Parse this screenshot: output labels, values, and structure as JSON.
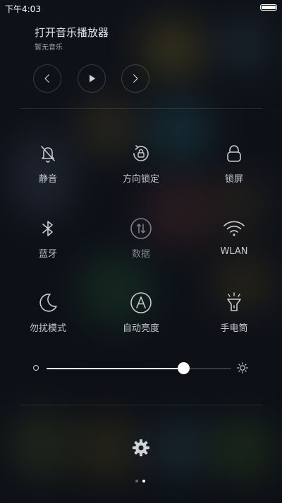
{
  "status": {
    "time": "下午4:03"
  },
  "music": {
    "title": "打开音乐播放器",
    "subtitle": "暂无音乐",
    "controls": [
      "chevron-left-icon",
      "play-icon",
      "chevron-right-icon"
    ]
  },
  "toggles": [
    {
      "label": "静音",
      "icon": "bell-off-icon",
      "active": true
    },
    {
      "label": "方向锁定",
      "icon": "rotation-lock-icon",
      "active": true
    },
    {
      "label": "锁屏",
      "icon": "lock-icon",
      "active": true
    },
    {
      "label": "蓝牙",
      "icon": "bluetooth-icon",
      "active": true
    },
    {
      "label": "数据",
      "icon": "mobile-data-icon",
      "active": false
    },
    {
      "label": "WLAN",
      "icon": "wifi-icon",
      "active": true
    },
    {
      "label": "勿扰模式",
      "icon": "moon-icon",
      "active": true
    },
    {
      "label": "自动亮度",
      "icon": "auto-brightness-icon",
      "active": true
    },
    {
      "label": "手电筒",
      "icon": "flashlight-icon",
      "active": true
    }
  ],
  "brightness": {
    "level": 0.74
  },
  "pager": {
    "count": 2,
    "current": 1
  },
  "colors": {
    "accent": "#ffffff",
    "text": "#c7cbd1",
    "dim": "#7c838b"
  }
}
